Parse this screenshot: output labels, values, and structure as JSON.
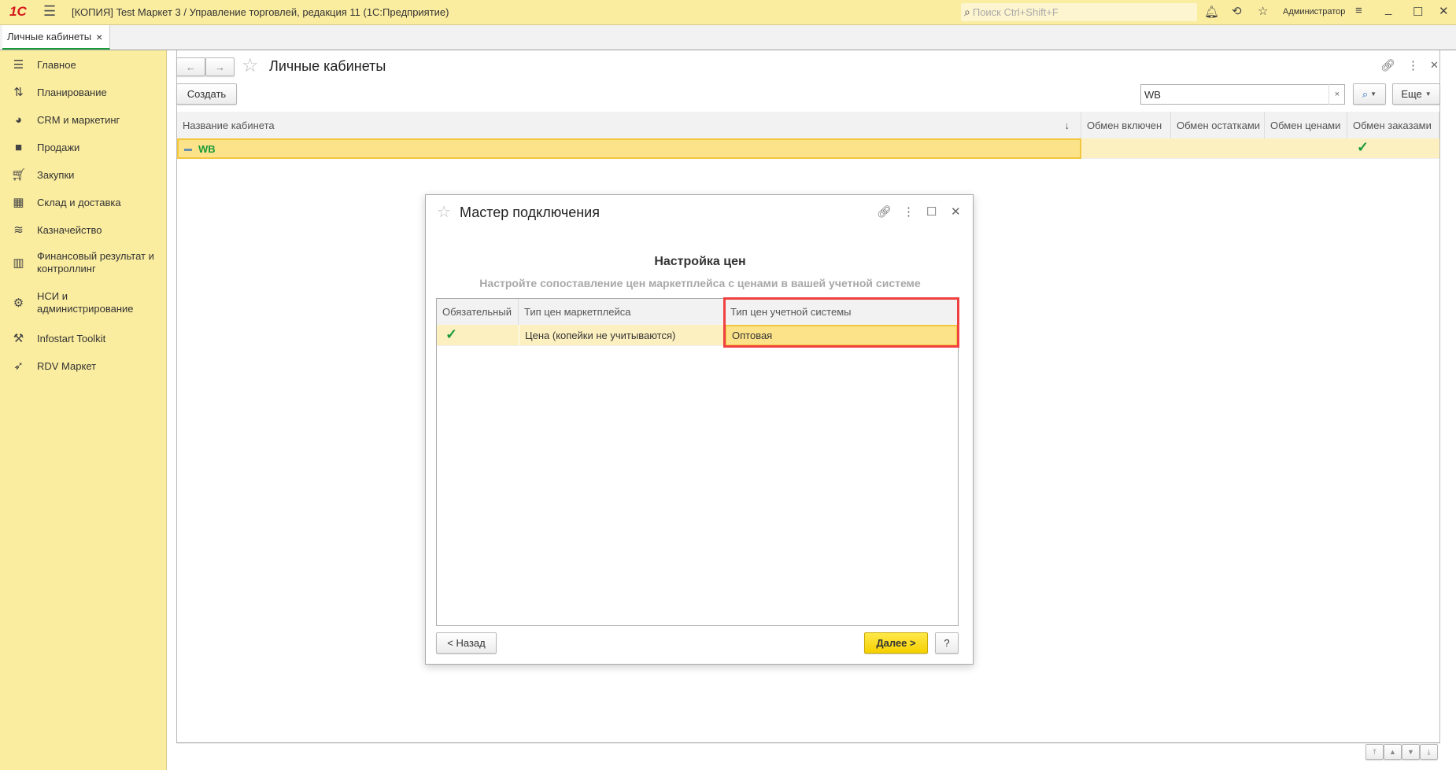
{
  "app": {
    "title": "[КОПИЯ] Test Маркет 3 / Управление торговлей, редакция 11  (1С:Предприятие)",
    "search_placeholder": "Поиск Ctrl+Shift+F",
    "user": "Администратор",
    "logo": "1С"
  },
  "tabs": [
    {
      "label": "Личные кабинеты",
      "close": "×"
    }
  ],
  "sidebar": {
    "items": [
      {
        "label": "Главное",
        "icon": "menu-icon"
      },
      {
        "label": "Планирование",
        "icon": "planning-icon"
      },
      {
        "label": "CRM и маркетинг",
        "icon": "pie-chart-icon"
      },
      {
        "label": "Продажи",
        "icon": "bag-icon"
      },
      {
        "label": "Закупки",
        "icon": "cart-icon"
      },
      {
        "label": "Склад и доставка",
        "icon": "grid-icon"
      },
      {
        "label": "Казначейство",
        "icon": "coins-icon"
      },
      {
        "label": "Финансовый результат и контроллинг",
        "icon": "bar-chart-icon"
      },
      {
        "label": "НСИ и администрирование",
        "icon": "gear-icon"
      },
      {
        "label": "Infostart Toolkit",
        "icon": "tools-icon"
      },
      {
        "label": "RDV Маркет",
        "icon": "rocket-icon"
      }
    ]
  },
  "form": {
    "title": "Личные кабинеты",
    "create_label": "Создать",
    "search_value": "WB",
    "more_label": "Еще",
    "columns": [
      "Название кабинета",
      "Обмен включен",
      "Обмен остатками",
      "Обмен ценами",
      "Обмен заказами"
    ],
    "sort_indicator": "↓",
    "rows": [
      {
        "name": "WB",
        "exchange_enabled": false,
        "stock": false,
        "prices": false,
        "orders": true
      }
    ]
  },
  "dialog": {
    "title": "Мастер подключения",
    "heading": "Настройка цен",
    "subtitle": "Настройте сопоставление цен маркетплейса с ценами в вашей учетной системе",
    "columns": [
      "Обязательный",
      "Тип цен маркетплейса",
      "Тип цен учетной системы"
    ],
    "rows": [
      {
        "required": true,
        "marketplace_price": "Цена (копейки не учитываются)",
        "system_price": "Оптовая"
      }
    ],
    "back_label": "< Назад",
    "next_label": "Далее >",
    "help_label": "?"
  },
  "colors": {
    "accent": "#fbeda0",
    "highlight": "#f04040",
    "primary_button": "#f5d800",
    "selection": "#fce38a"
  }
}
